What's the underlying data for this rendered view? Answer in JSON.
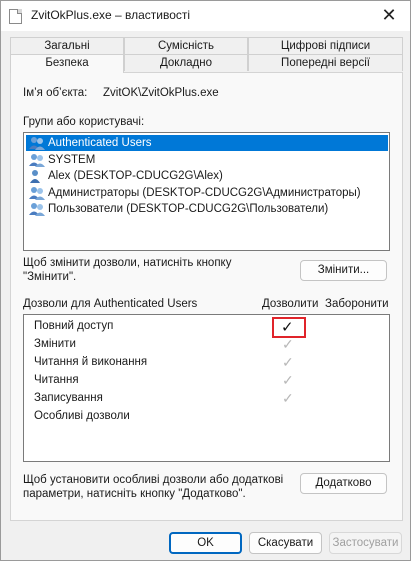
{
  "window": {
    "title": "ZvitOkPlus.exe – властивості",
    "close_glyph": "✕"
  },
  "tabs": {
    "row1": [
      "Загальні",
      "Сумісність",
      "Цифрові підписи"
    ],
    "row2": [
      "Безпека",
      "Докладно",
      "Попередні версії"
    ],
    "active": "Безпека"
  },
  "security": {
    "object_label": "Ім’я об’єкта:",
    "object_value": "ZvitOK\\ZvitOkPlus.exe",
    "groups_label": "Групи або користувачі:",
    "users": [
      {
        "label": "Authenticated Users",
        "icon": "users-group-icon",
        "selected": true
      },
      {
        "label": "SYSTEM",
        "icon": "users-group-icon",
        "selected": false
      },
      {
        "label": "Alex (DESKTOP-CDUCG2G\\Alex)",
        "icon": "user-icon",
        "selected": false
      },
      {
        "label": "Администраторы (DESKTOP-CDUCG2G\\Администраторы)",
        "icon": "users-group-icon",
        "selected": false
      },
      {
        "label": "Пользователи (DESKTOP-CDUCG2G\\Пользователи)",
        "icon": "users-group-icon",
        "selected": false
      }
    ],
    "change_hint_line1": "Щоб змінити дозволи, натисніть кнопку",
    "change_hint_line2": "\"Змінити\".",
    "change_button": "Змінити...",
    "permissions_label": "Дозволи для Authenticated Users",
    "allow_header": "Дозволити",
    "deny_header": "Заборонити",
    "permissions": [
      {
        "name": "Повний доступ",
        "allow": "✓"
      },
      {
        "name": "Змінити",
        "allow": "✓"
      },
      {
        "name": "Читання й виконання",
        "allow": "✓"
      },
      {
        "name": "Читання",
        "allow": "✓"
      },
      {
        "name": "Записування",
        "allow": "✓"
      },
      {
        "name": "Особливі дозволи",
        "allow": ""
      }
    ],
    "advanced_hint_line1": "Щоб установити особливі дозволи або додаткові",
    "advanced_hint_line2": "параметри, натисніть кнопку \"Додатково\".",
    "advanced_button": "Додатково"
  },
  "footer": {
    "ok": "OK",
    "cancel": "Скасувати",
    "apply": "Застосувати"
  },
  "colors": {
    "selection": "#0078d7",
    "highlight": "#e0242a",
    "primary_border": "#0067c0"
  }
}
